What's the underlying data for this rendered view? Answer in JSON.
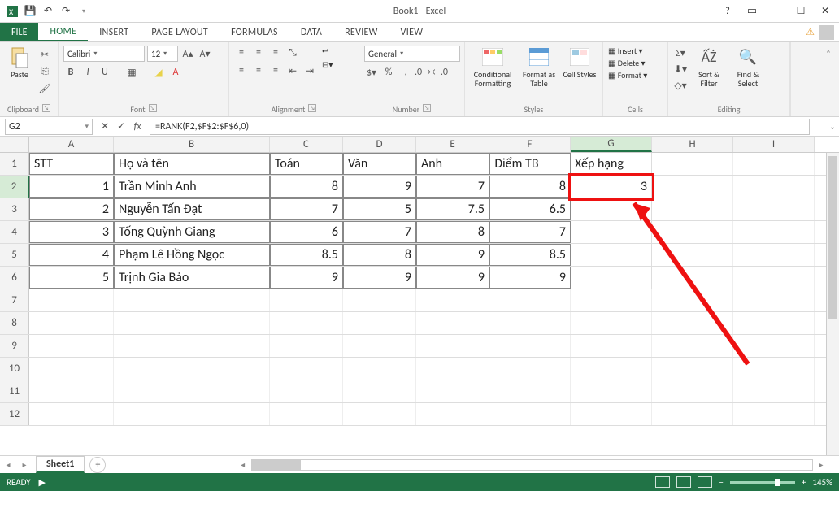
{
  "app": {
    "title": "Book1 - Excel"
  },
  "qat": {
    "save": "💾",
    "undo": "↶",
    "redo": "↷"
  },
  "tabs": {
    "file": "FILE",
    "items": [
      "HOME",
      "INSERT",
      "PAGE LAYOUT",
      "FORMULAS",
      "DATA",
      "REVIEW",
      "VIEW"
    ],
    "active": 0
  },
  "ribbon": {
    "clipboard": {
      "label": "Clipboard",
      "paste": "Paste"
    },
    "font": {
      "label": "Font",
      "name": "Calibri",
      "size": "12",
      "bold": "B",
      "italic": "I",
      "underline": "U"
    },
    "alignment": {
      "label": "Alignment",
      "wrap": "Wrap Text",
      "merge": "Merge & Center"
    },
    "number": {
      "label": "Number",
      "format": "General"
    },
    "styles": {
      "label": "Styles",
      "cond": "Conditional Formatting",
      "table": "Format as Table",
      "cell": "Cell Styles"
    },
    "cells": {
      "label": "Cells",
      "insert": "Insert",
      "delete": "Delete",
      "format": "Format"
    },
    "editing": {
      "label": "Editing",
      "sort": "Sort & Filter",
      "find": "Find & Select"
    }
  },
  "formula": {
    "cellref": "G2",
    "fx": "fx",
    "value": "=RANK(F2,$F$2:$F$6,0)"
  },
  "columns": [
    {
      "letter": "A",
      "w": 104
    },
    {
      "letter": "B",
      "w": 192
    },
    {
      "letter": "C",
      "w": 90
    },
    {
      "letter": "D",
      "w": 90
    },
    {
      "letter": "E",
      "w": 90
    },
    {
      "letter": "F",
      "w": 100
    },
    {
      "letter": "G",
      "w": 100
    },
    {
      "letter": "H",
      "w": 100
    },
    {
      "letter": "I",
      "w": 100
    }
  ],
  "headers": [
    "STT",
    "Họ và tên",
    "Toán",
    "Văn",
    "Anh",
    "Điểm TB",
    "Xếp hạng"
  ],
  "rows": [
    {
      "stt": "1",
      "name": "Trần Minh Anh",
      "toan": "8",
      "van": "9",
      "anh": "7",
      "tb": "8",
      "xep": "3"
    },
    {
      "stt": "2",
      "name": "Nguyễn Tấn Đạt",
      "toan": "7",
      "van": "5",
      "anh": "7.5",
      "tb": "6.5",
      "xep": ""
    },
    {
      "stt": "3",
      "name": "Tống Quỳnh Giang",
      "toan": "6",
      "van": "7",
      "anh": "8",
      "tb": "7",
      "xep": ""
    },
    {
      "stt": "4",
      "name": "Phạm Lê Hồng Ngọc",
      "toan": "8.5",
      "van": "8",
      "anh": "9",
      "tb": "8.5",
      "xep": ""
    },
    {
      "stt": "5",
      "name": "Trịnh Gia Bảo",
      "toan": "9",
      "van": "9",
      "anh": "9",
      "tb": "9",
      "xep": ""
    }
  ],
  "sheets": {
    "active": "Sheet1"
  },
  "status": {
    "ready": "READY",
    "zoom": "145%"
  }
}
